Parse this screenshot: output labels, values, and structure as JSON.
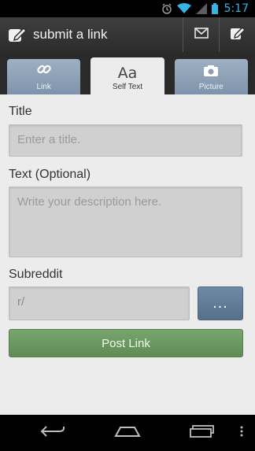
{
  "status_bar": {
    "time": "5:17"
  },
  "action_bar": {
    "title": "submit a link"
  },
  "tabs": [
    {
      "label": "Link",
      "icon": "link-icon"
    },
    {
      "label": "Self Text",
      "glyph": "Aa"
    },
    {
      "label": "Picture",
      "icon": "camera-icon"
    }
  ],
  "form": {
    "title_label": "Title",
    "title_placeholder": "Enter a title.",
    "text_label": "Text (Optional)",
    "text_placeholder": "Write your description here.",
    "subreddit_label": "Subreddit",
    "subreddit_value": "r/",
    "more_button": "...",
    "post_button": "Post Link"
  },
  "colors": {
    "status_accent": "#33b5e5",
    "tab_inactive": "#8a9db3",
    "more_button": "#5f7a97",
    "post_button": "#6b9860"
  }
}
